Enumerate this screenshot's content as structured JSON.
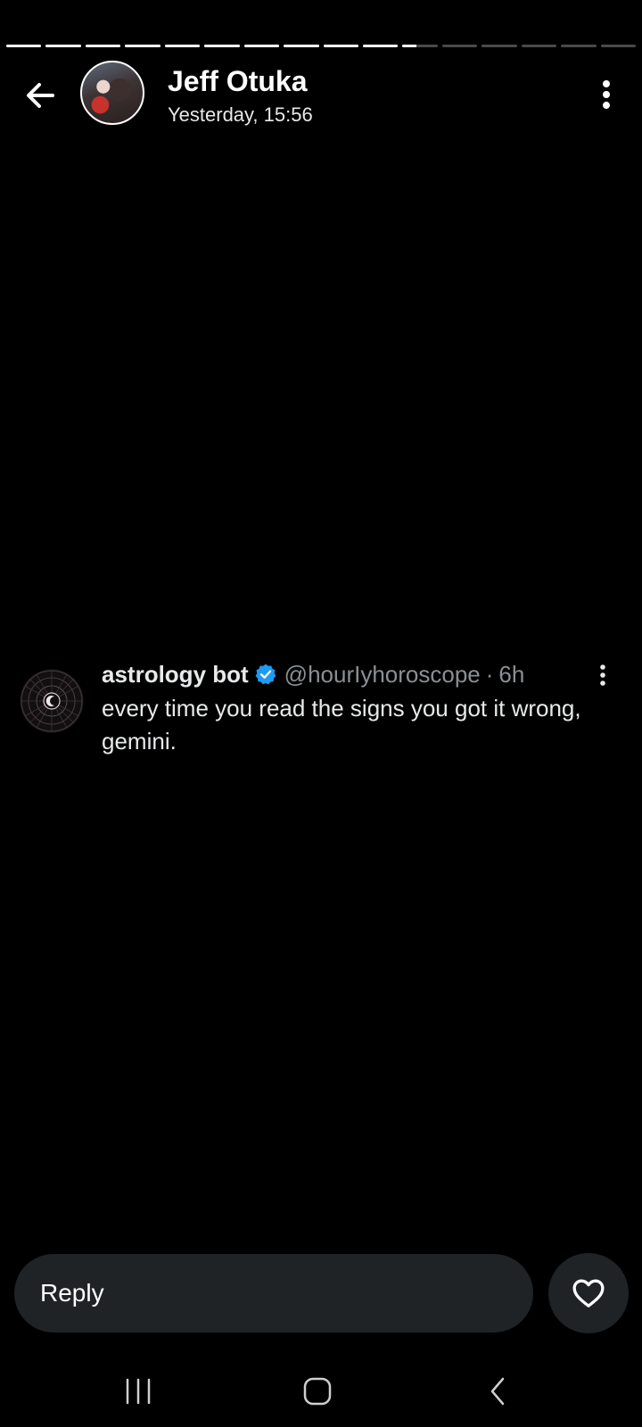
{
  "story": {
    "segments_total": 16,
    "segments_completed": 10,
    "current_segment_progress": 0.4
  },
  "header": {
    "name": "Jeff Otuka",
    "timestamp": "Yesterday, 15:56",
    "back_icon": "arrow-left-icon",
    "more_icon": "more-vertical-icon"
  },
  "tweet": {
    "author_name": "astrology bot",
    "verified": true,
    "verified_color": "#1d9bf0",
    "handle": "@hourIyhoroscope",
    "separator": "·",
    "age": "6h",
    "text": "every time you read the signs you got it wrong, gemini.",
    "more_icon": "more-vertical-icon"
  },
  "reply": {
    "placeholder": "Reply",
    "like_icon": "heart-outline-icon"
  },
  "navbar": {
    "recents_icon": "recents-icon",
    "home_icon": "home-icon",
    "back_icon": "nav-back-icon"
  },
  "colors": {
    "background": "#000000",
    "surface": "#1f2326",
    "text_primary": "#e7e9ea",
    "text_secondary": "#8b8f94"
  }
}
